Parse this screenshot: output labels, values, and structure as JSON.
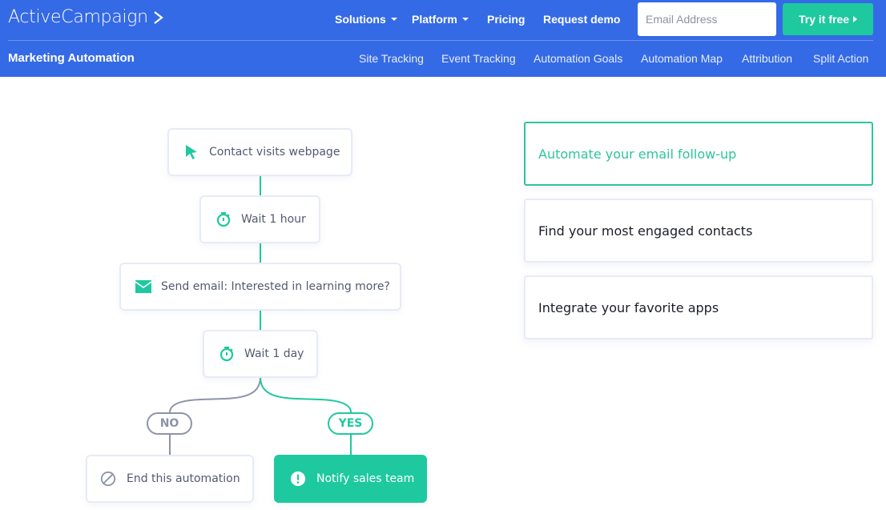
{
  "header": {
    "logo_text": "ActiveCampaign",
    "nav": [
      {
        "label": "Solutions",
        "has_dropdown": true
      },
      {
        "label": "Platform",
        "has_dropdown": true
      },
      {
        "label": "Pricing",
        "has_dropdown": false
      },
      {
        "label": "Request demo",
        "has_dropdown": false
      }
    ],
    "email_placeholder": "Email Address",
    "email_value": "",
    "cta_label": "Try it free",
    "section_title": "Marketing Automation",
    "subnav": [
      "Site Tracking",
      "Event Tracking",
      "Automation Goals",
      "Automation Map",
      "Attribution",
      "Split Action"
    ]
  },
  "flow": {
    "steps": [
      {
        "icon": "cursor-icon",
        "label": "Contact visits webpage"
      },
      {
        "icon": "stopwatch-icon",
        "label": "Wait 1 hour"
      },
      {
        "icon": "envelope-icon",
        "label": "Send email: Interested in learning more?"
      },
      {
        "icon": "stopwatch-icon",
        "label": "Wait 1 day"
      }
    ],
    "branches": {
      "no": {
        "label": "NO",
        "action_icon": "prohibited-icon",
        "action_label": "End this automation"
      },
      "yes": {
        "label": "YES",
        "action_icon": "exclamation-icon",
        "action_label": "Notify sales team"
      }
    }
  },
  "features": [
    {
      "label": "Automate your email follow-up",
      "active": true
    },
    {
      "label": "Find your most engaged contacts",
      "active": false
    },
    {
      "label": "Integrate your favorite apps",
      "active": false
    }
  ],
  "colors": {
    "brand_blue": "#356ae6",
    "accent_green": "#1ec99f",
    "neutral_gray": "#8e93a8"
  }
}
